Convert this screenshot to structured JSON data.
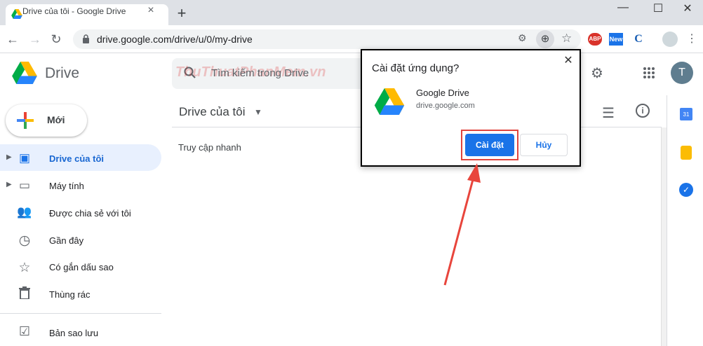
{
  "browser": {
    "tab_title": "Drive của tôi - Google Drive",
    "tab_close": "×",
    "new_tab": "+",
    "url": "drive.google.com/drive/u/0/my-drive",
    "window": {
      "minimize": "—",
      "maximize": "☐",
      "close": "✕"
    },
    "extensions": {
      "abp": "ABP",
      "new": "New",
      "c": "C"
    }
  },
  "drive": {
    "title": "Drive",
    "search_placeholder": "Tìm kiếm trong Drive",
    "watermark": "ThuThuatPhanMem.vn",
    "new_button": "Mới",
    "avatar": "T",
    "breadcrumb": "Drive của tôi",
    "quick_access": "Truy cập nhanh",
    "sidebar": [
      {
        "label": "Drive của tôi",
        "icon": "my-drive-icon"
      },
      {
        "label": "Máy tính",
        "icon": "computer-icon"
      },
      {
        "label": "Được chia sẻ với tôi",
        "icon": "shared-icon"
      },
      {
        "label": "Gần đây",
        "icon": "clock-icon"
      },
      {
        "label": "Có gắn dấu sao",
        "icon": "star-icon"
      },
      {
        "label": "Thùng rác",
        "icon": "trash-icon"
      },
      {
        "label": "Bản sao lưu",
        "icon": "backup-icon"
      }
    ]
  },
  "dialog": {
    "title": "Cài đặt ứng dụng?",
    "app_name": "Google Drive",
    "app_url": "drive.google.com",
    "install": "Cài đặt",
    "cancel": "Hủy",
    "close": "✕"
  },
  "colors": {
    "accent": "#1a73e8",
    "highlight": "#e0443e",
    "active_bg": "#e8f0fe"
  }
}
